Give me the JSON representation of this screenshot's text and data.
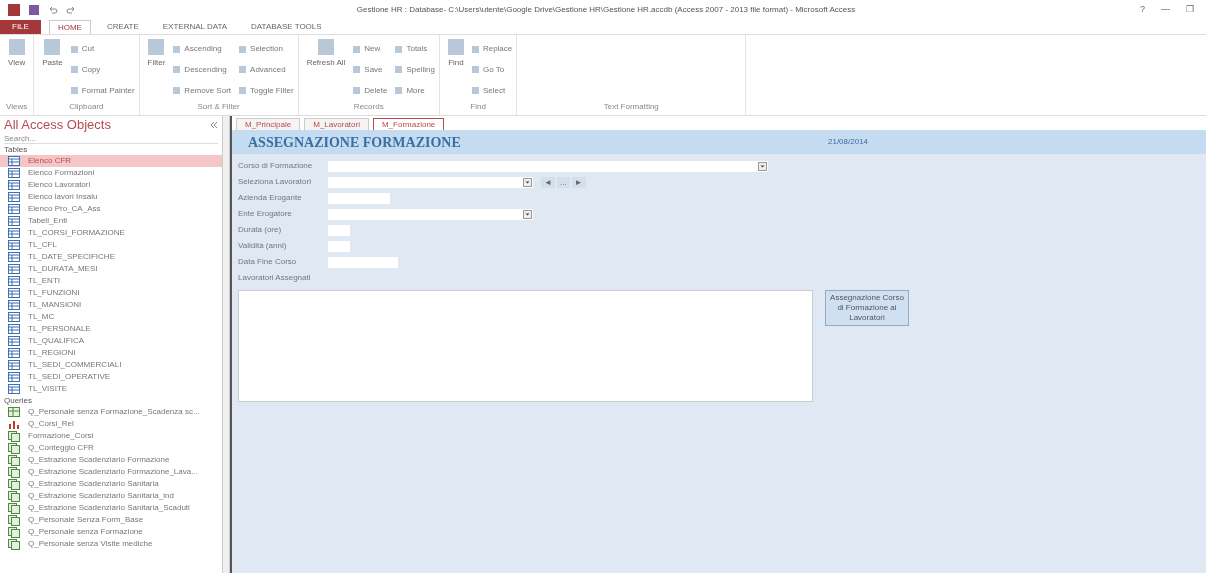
{
  "window": {
    "title": "Gestione HR : Database- C:\\Users\\utente\\Google Drive\\Gestione HR\\Gestione HR.accdb (Access 2007 - 2013 file format) - Microsoft Access",
    "controls": [
      "?",
      "—",
      "❐"
    ]
  },
  "file_tab": "FILE",
  "ribbon_tabs": [
    {
      "label": "HOME",
      "selected": true
    },
    {
      "label": "CREATE",
      "selected": false
    },
    {
      "label": "EXTERNAL DATA",
      "selected": false
    },
    {
      "label": "DATABASE TOOLS",
      "selected": false
    }
  ],
  "ribbon_groups": [
    {
      "name": "Views",
      "large": [
        "View"
      ]
    },
    {
      "name": "Clipboard",
      "large": [
        "Paste"
      ],
      "small": [
        "Cut",
        "Copy",
        "Format Painter"
      ]
    },
    {
      "name": "Sort & Filter",
      "large": [
        "Filter"
      ],
      "small": [
        "Ascending",
        "Descending",
        "Remove Sort",
        "Selection",
        "Advanced",
        "Toggle Filter"
      ]
    },
    {
      "name": "Records",
      "large": [
        "Refresh All"
      ],
      "small": [
        "New",
        "Save",
        "Delete",
        "Totals",
        "Spelling",
        "More"
      ]
    },
    {
      "name": "Find",
      "large": [
        "Find"
      ],
      "small": [
        "Replace",
        "Go To",
        "Select"
      ]
    },
    {
      "name": "Text Formatting"
    }
  ],
  "nav": {
    "title": "All Access Objects",
    "search_placeholder": "Search...",
    "sections": [
      {
        "label": "Tables",
        "items": [
          {
            "label": "Elenco CFR",
            "kind": "table",
            "selected": true
          },
          {
            "label": "Elenco Formazioni",
            "kind": "table",
            "selected": false
          },
          {
            "label": "Elenco Lavoratori",
            "kind": "table",
            "selected": false
          },
          {
            "label": "Elenco lavori Insalu",
            "kind": "table",
            "selected": false
          },
          {
            "label": "Elenco Pro_CA_Ass",
            "kind": "table",
            "selected": false
          },
          {
            "label": "Tabell_Enti",
            "kind": "table",
            "selected": false
          },
          {
            "label": "TL_CORSI_FORMAZIONE",
            "kind": "table",
            "selected": false
          },
          {
            "label": "TL_CFL",
            "kind": "table",
            "selected": false
          },
          {
            "label": "TL_DATE_SPECIFICHE",
            "kind": "table",
            "selected": false
          },
          {
            "label": "TL_DURATA_MESI",
            "kind": "table",
            "selected": false
          },
          {
            "label": "TL_ENTI",
            "kind": "table",
            "selected": false
          },
          {
            "label": "TL_FUNZIONI",
            "kind": "table",
            "selected": false
          },
          {
            "label": "TL_MANSIONI",
            "kind": "table",
            "selected": false
          },
          {
            "label": "TL_MC",
            "kind": "table",
            "selected": false
          },
          {
            "label": "TL_PERSONALE",
            "kind": "table",
            "selected": false
          },
          {
            "label": "TL_QUALIFICA",
            "kind": "table",
            "selected": false
          },
          {
            "label": "TL_REGIONI",
            "kind": "table",
            "selected": false
          },
          {
            "label": "TL_SEDI_COMMERCIALI",
            "kind": "table",
            "selected": false
          },
          {
            "label": "TL_SEDI_OPERATIVE",
            "kind": "table",
            "selected": false
          },
          {
            "label": "TL_VISITE",
            "kind": "table",
            "selected": false
          }
        ]
      },
      {
        "label": "Queries",
        "items": [
          {
            "label": "Q_Personale senza Formazione_Scadenza sc...",
            "kind": "crosstab",
            "selected": false
          },
          {
            "label": "Q_Corsi_Rel",
            "kind": "chart",
            "selected": false
          },
          {
            "label": "Formazione_Corsi",
            "kind": "query",
            "selected": false
          },
          {
            "label": "Q_Conteggio CFR",
            "kind": "query",
            "selected": false
          },
          {
            "label": "Q_Estrazione Scadenziario Formazione",
            "kind": "query",
            "selected": false
          },
          {
            "label": "Q_Estrazione Scadenziario Formazione_Lava...",
            "kind": "query",
            "selected": false
          },
          {
            "label": "Q_Estrazione Scadenziario Sanitaria",
            "kind": "query",
            "selected": false
          },
          {
            "label": "Q_Estrazione Scadenziario Sanitaria_ind",
            "kind": "query",
            "selected": false
          },
          {
            "label": "Q_Estrazione Scadenziario Sanitaria_Scaduti",
            "kind": "query",
            "selected": false
          },
          {
            "label": "Q_Personale Senza Form_Base",
            "kind": "query",
            "selected": false
          },
          {
            "label": "Q_Personale senza Formazione",
            "kind": "query",
            "selected": false
          },
          {
            "label": "Q_Personale senza Visite mediche",
            "kind": "query",
            "selected": false
          }
        ]
      }
    ]
  },
  "doc_tabs": [
    {
      "label": "M_Principale",
      "selected": false
    },
    {
      "label": "M_Lavoratori",
      "selected": false
    },
    {
      "label": "M_Formazione",
      "selected": true
    }
  ],
  "form": {
    "title": "ASSEGNAZIONE FORMAZIONE",
    "date": "21/08/2014",
    "fields": [
      {
        "label": "Corso di Formazione",
        "kind": "combo"
      },
      {
        "label": "Seleziona Lavoratori",
        "kind": "combo_nav"
      },
      {
        "label": "Azienda Erogante",
        "kind": "text"
      },
      {
        "label": "Ente Erogatore",
        "kind": "combo"
      },
      {
        "label": "Durata (ore)",
        "kind": "text"
      },
      {
        "label": "Validità (anni)",
        "kind": "text"
      },
      {
        "label": "Data Fine Corso",
        "kind": "text"
      }
    ],
    "nav_buttons": [
      "◄",
      "...",
      "►"
    ],
    "list_label": "Lavoratori Assegnati",
    "action_button": "Assegnazione Corso di Formazione ai Lavoratori"
  }
}
